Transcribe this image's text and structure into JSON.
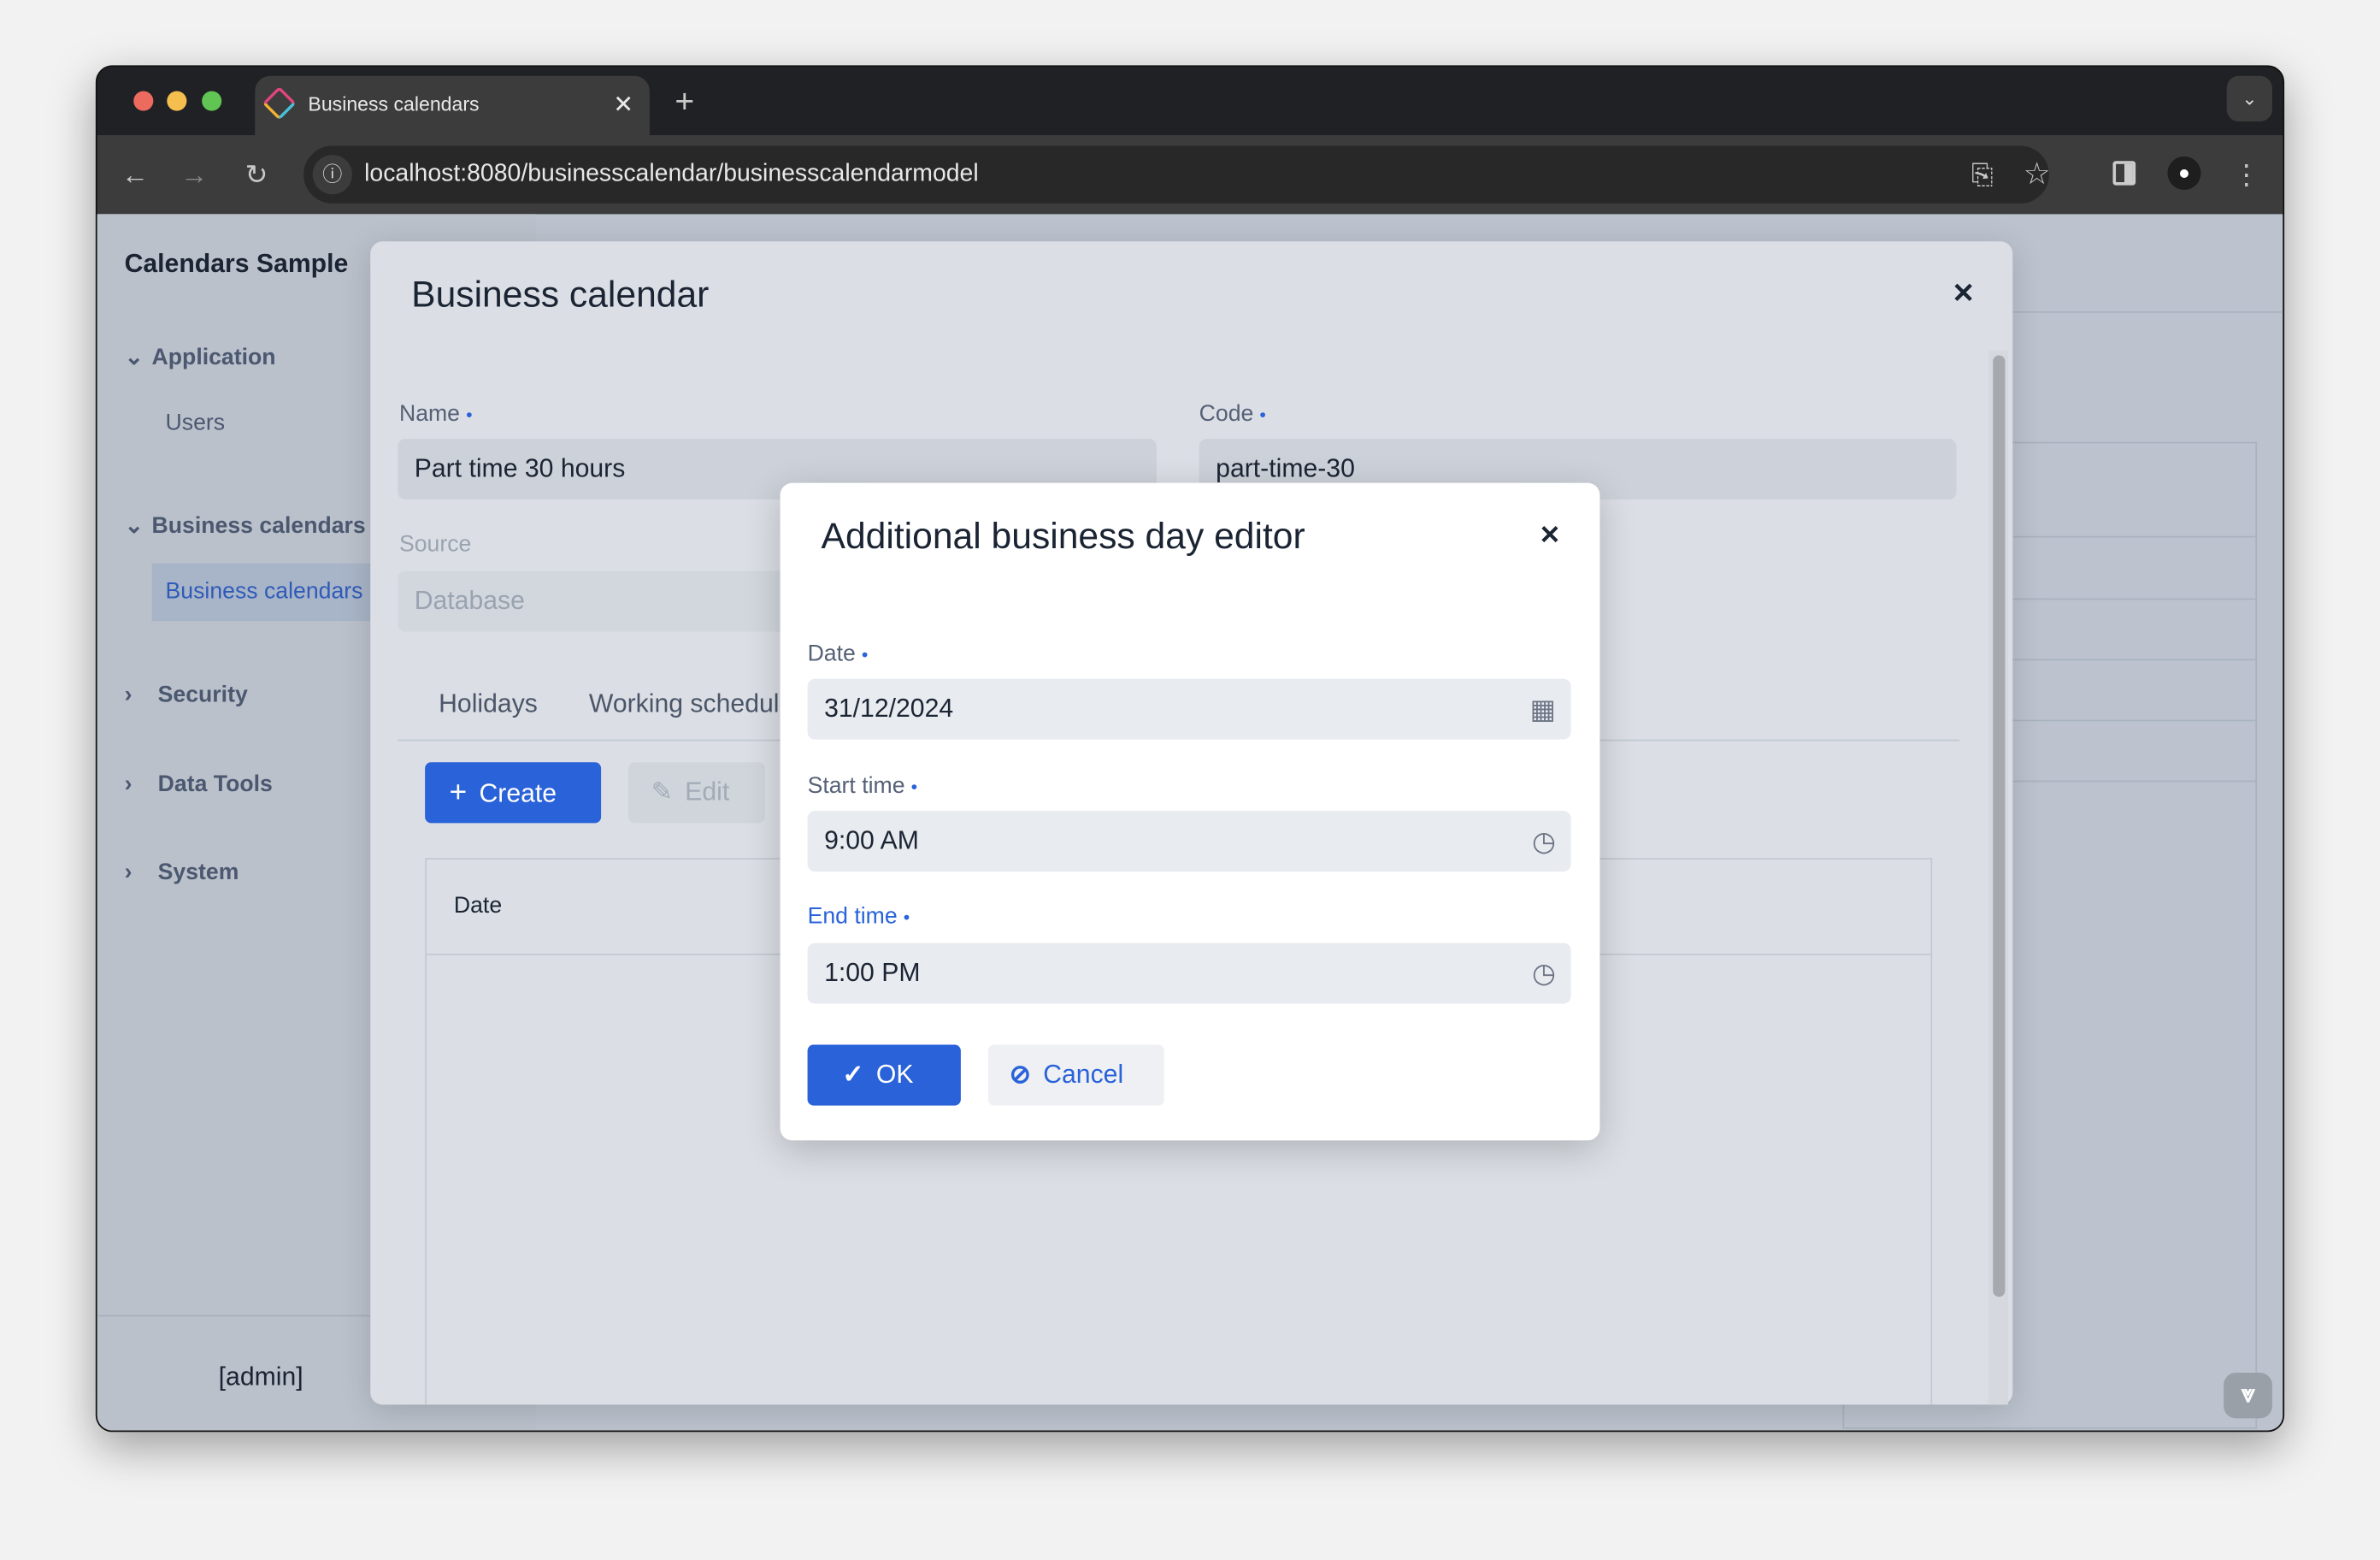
{
  "browser": {
    "tab_title": "Business calendars",
    "url": "localhost:8080/businesscalendar/businesscalendarmodel",
    "traffic_colors": [
      "#ed6a5e",
      "#f5bf4f",
      "#61c554"
    ]
  },
  "sidebar": {
    "title": "Calendars Sample",
    "groups": [
      {
        "label": "Application",
        "expanded": true,
        "items": [
          "Users"
        ]
      },
      {
        "label": "Business calendars",
        "expanded": true,
        "items": [
          "Business calendars"
        ]
      },
      {
        "label": "Security",
        "expanded": false
      },
      {
        "label": "Data Tools",
        "expanded": false
      },
      {
        "label": "System",
        "expanded": false
      }
    ],
    "user": "[admin]"
  },
  "calendar_dialog": {
    "title": "Business calendar",
    "name_label": "Name",
    "name_value": "Part time 30 hours",
    "code_label": "Code",
    "code_value": "part-time-30",
    "source_label": "Source",
    "source_value": "Database",
    "tabs": [
      "Holidays",
      "Working schedule"
    ],
    "create_label": "Create",
    "edit_label": "Edit",
    "table_header_date": "Date"
  },
  "day_editor": {
    "title": "Additional business day editor",
    "date_label": "Date",
    "date_value": "31/12/2024",
    "start_label": "Start time",
    "start_value": "9:00 AM",
    "end_label": "End time",
    "end_value": "1:00 PM",
    "ok_label": "OK",
    "cancel_label": "Cancel",
    "accent_color": "#2962d9"
  }
}
